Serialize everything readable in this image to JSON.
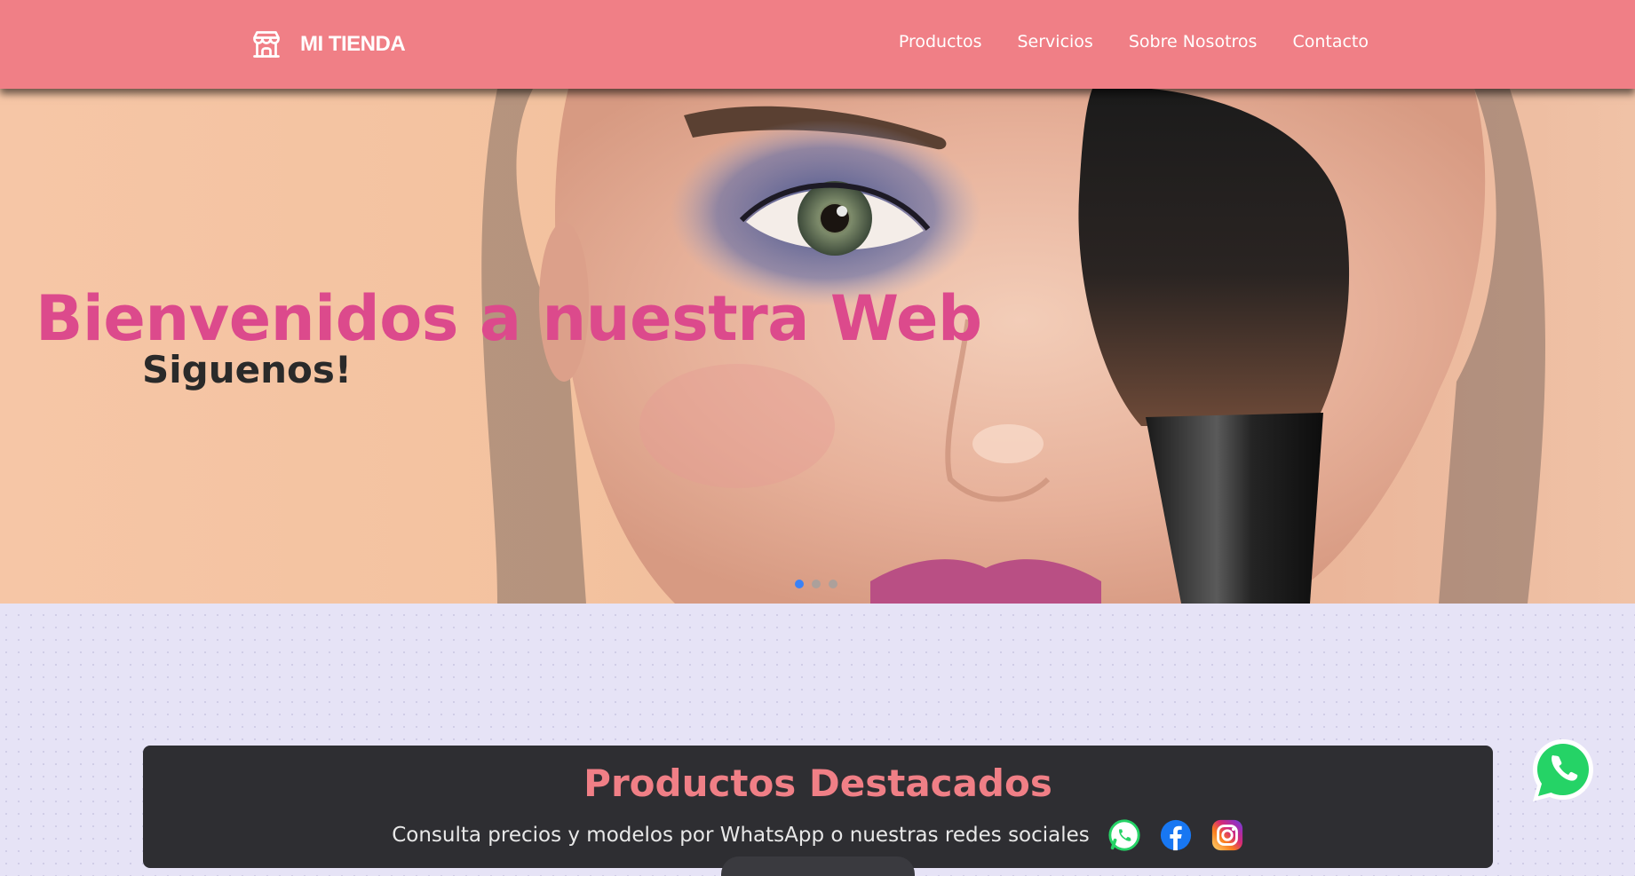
{
  "header": {
    "brand_name": "MI TIENDA",
    "brand_icon": "store-icon",
    "nav": [
      {
        "label": "Productos"
      },
      {
        "label": "Servicios"
      },
      {
        "label": "Sobre Nosotros"
      },
      {
        "label": "Contacto"
      }
    ]
  },
  "hero": {
    "title": "Bienvenidos a nuestra Web",
    "subtitle": "Siguenos!",
    "slides_count": 3,
    "active_slide": 1
  },
  "featured": {
    "title": "Productos Destacados",
    "subtitle": "Consulta precios y modelos por WhatsApp o nuestras redes sociales",
    "socials": [
      {
        "name": "whatsapp-icon"
      },
      {
        "name": "facebook-icon"
      },
      {
        "name": "instagram-icon"
      }
    ]
  },
  "floating": {
    "icon": "whatsapp-icon"
  },
  "colors": {
    "navbar": "#f07f86",
    "hero_title": "#dc4a8c",
    "featured_bg": "#2e2e32",
    "page_bg": "#e6e3f6"
  }
}
